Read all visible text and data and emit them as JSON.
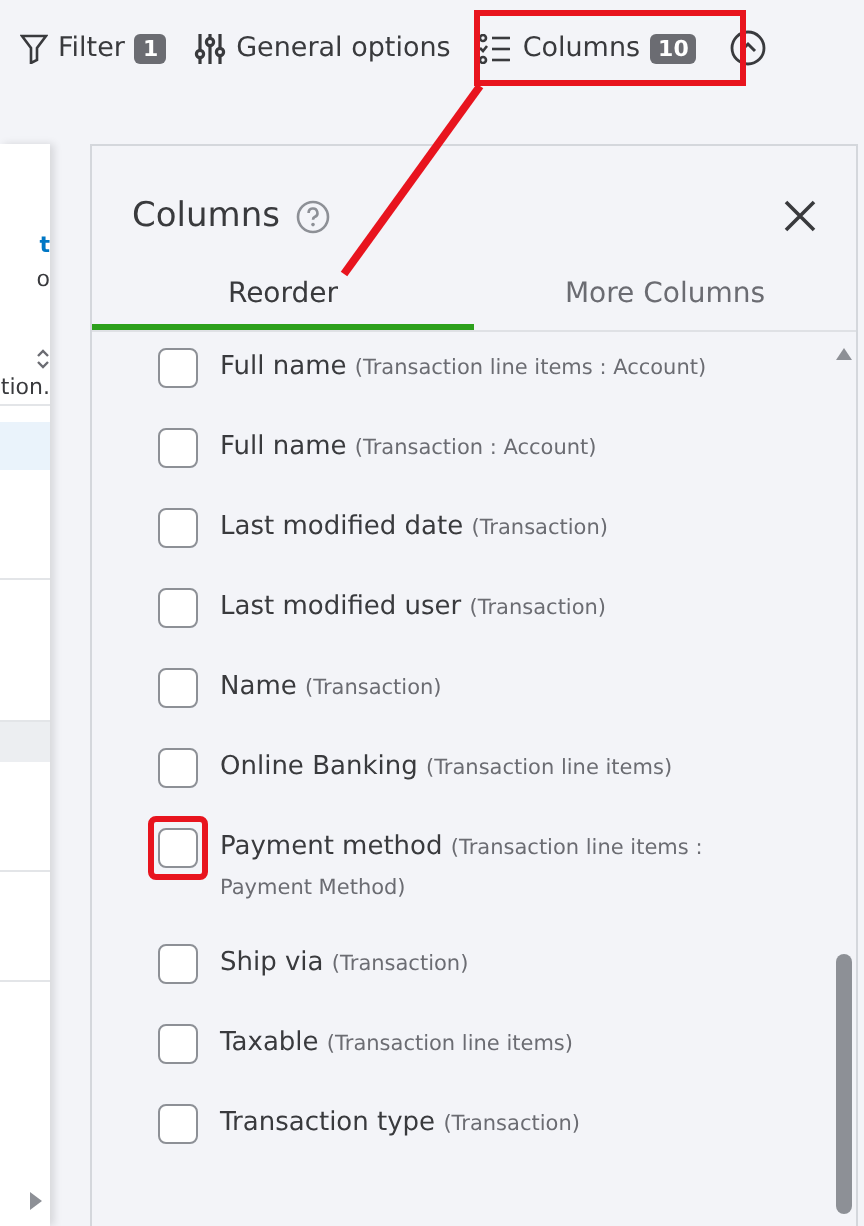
{
  "toolbar": {
    "filter": {
      "label": "Filter",
      "count": "1"
    },
    "general_options": {
      "label": "General options"
    },
    "columns": {
      "label": "Columns",
      "count": "10"
    }
  },
  "background_table": {
    "link_fragment": "t",
    "text_fragment": "o",
    "column_fragment": "tion."
  },
  "panel": {
    "title": "Columns",
    "tabs": [
      {
        "label": "Reorder",
        "selected": true
      },
      {
        "label": "More Columns",
        "selected": false
      }
    ],
    "items": [
      {
        "name": "Full name",
        "context": "(Transaction line items : Account)",
        "checked": false
      },
      {
        "name": "Full name",
        "context": "(Transaction : Account)",
        "checked": false
      },
      {
        "name": "Last modified date",
        "context": "(Transaction)",
        "checked": false
      },
      {
        "name": "Last modified user",
        "context": "(Transaction)",
        "checked": false
      },
      {
        "name": "Name",
        "context": "(Transaction)",
        "checked": false
      },
      {
        "name": "Online Banking",
        "context": "(Transaction line items)",
        "checked": false
      },
      {
        "name": "Payment method",
        "context": "(Transaction line items : Payment Method)",
        "checked": false,
        "highlighted": true
      },
      {
        "name": "Ship via",
        "context": "(Transaction)",
        "checked": false
      },
      {
        "name": "Taxable",
        "context": "(Transaction line items)",
        "checked": false
      },
      {
        "name": "Transaction type",
        "context": "(Transaction)",
        "checked": false
      }
    ]
  }
}
